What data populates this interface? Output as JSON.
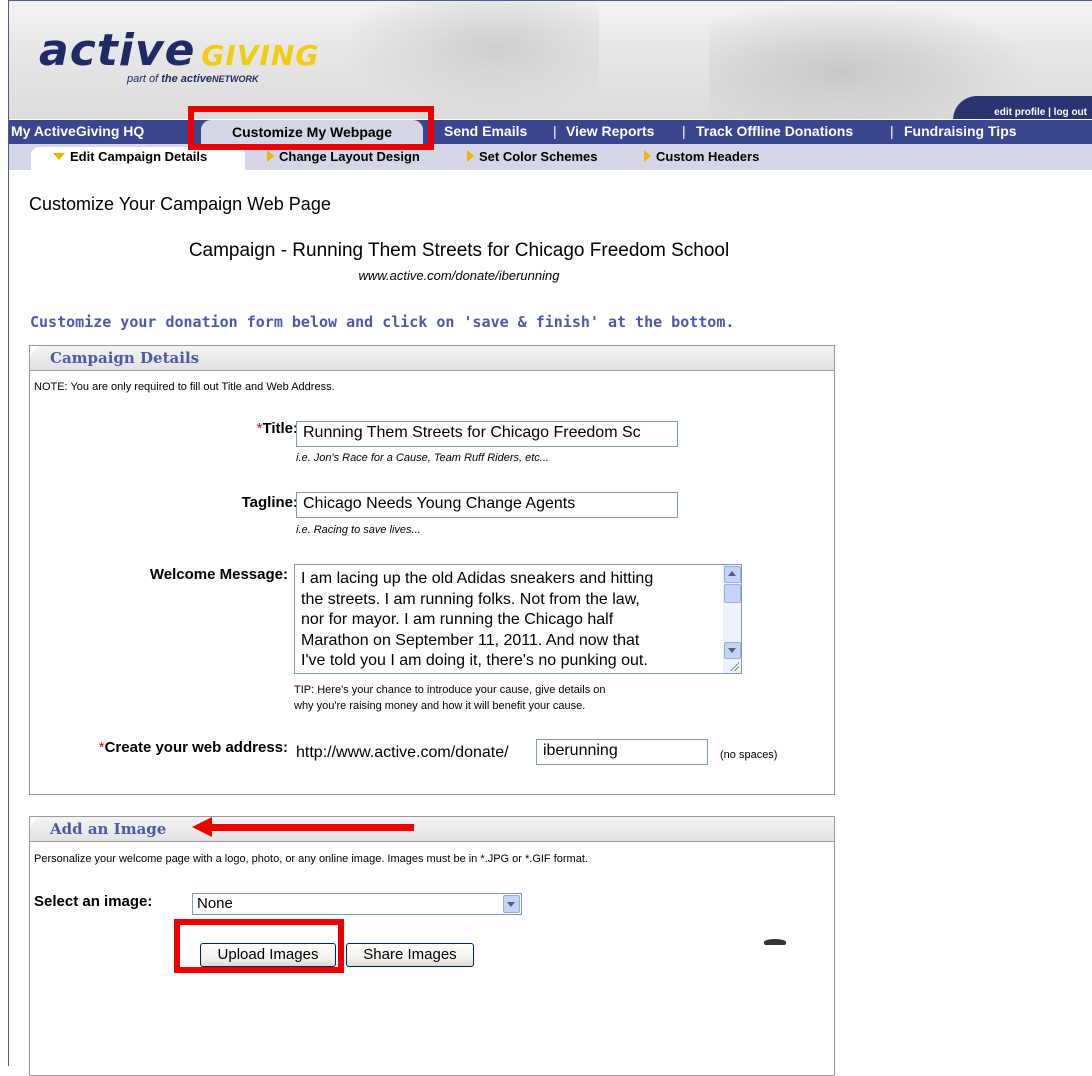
{
  "banner": {
    "logo_primary": "active",
    "logo_secondary": "GIVING",
    "logo_tagline_prefix": "part of",
    "logo_tagline_brand": "the active",
    "logo_tagline_suffix": "NETWORK",
    "edit_profile": "edit profile",
    "link_separator": "|",
    "log_out": "log out"
  },
  "main_nav": {
    "items": [
      {
        "label": "My ActiveGiving HQ"
      },
      {
        "label": "Customize My Webpage",
        "active": true
      },
      {
        "label": "Send Emails"
      },
      {
        "label": "View Reports"
      },
      {
        "label": "Track Offline Donations"
      },
      {
        "label": "Fundraising Tips"
      }
    ],
    "separator": "|",
    "background": "#3b4690",
    "active_tab_background": "#d4d6e6"
  },
  "sub_nav": {
    "items": [
      {
        "label": "Edit Campaign Details",
        "active": true
      },
      {
        "label": "Change Layout Design"
      },
      {
        "label": "Set Color Schemes"
      },
      {
        "label": "Custom Headers"
      }
    ],
    "bullet_color": "#f2b400"
  },
  "page": {
    "title": "Customize Your Campaign Web Page",
    "campaign_name": "Campaign - Running Them Streets for Chicago Freedom School",
    "campaign_url": "www.active.com/donate/iberunning",
    "instruction": "Customize your donation form below and click on 'save & finish' at the bottom.",
    "accent_color": "#4a5aa8"
  },
  "campaign_details": {
    "heading": "Campaign Details",
    "note": "NOTE: You are only required to fill out Title and Web Address.",
    "required_mark": "*",
    "title_label": "Title:",
    "title_value": "Running Them Streets for Chicago Freedom Sc",
    "title_hint": "i.e. Jon's Race for a Cause, Team Ruff Riders, etc...",
    "tagline_label": "Tagline:",
    "tagline_value": "Chicago Needs Young Change Agents",
    "tagline_hint": "i.e. Racing to save lives...",
    "welcome_label": "Welcome Message:",
    "welcome_lines": [
      "I am lacing up the old Adidas sneakers and hitting",
      "the streets.  I am running folks.  Not from the law,",
      "nor for mayor.  I am running the Chicago half",
      "Marathon on September 11, 2011.  And now that",
      "I've told you I am doing it, there's no punking out."
    ],
    "welcome_tip_line1": "TIP: Here's your chance to introduce your cause, give details on",
    "welcome_tip_line2": "why you're raising money and how it will benefit your cause.",
    "web_address_label": "Create your web address:",
    "web_address_prefix": "http://www.active.com/donate/",
    "web_address_value": "iberunning",
    "web_address_hint": "(no spaces)"
  },
  "add_image": {
    "heading": "Add an Image",
    "note": "Personalize your welcome page with a logo, photo, or any online image. Images must be in *.JPG or *.GIF format.",
    "select_label": "Select an image:",
    "select_value": "None",
    "upload_button": "Upload Images",
    "share_button": "Share Images"
  },
  "annotations": {
    "highlight_color": "#ee0000"
  }
}
